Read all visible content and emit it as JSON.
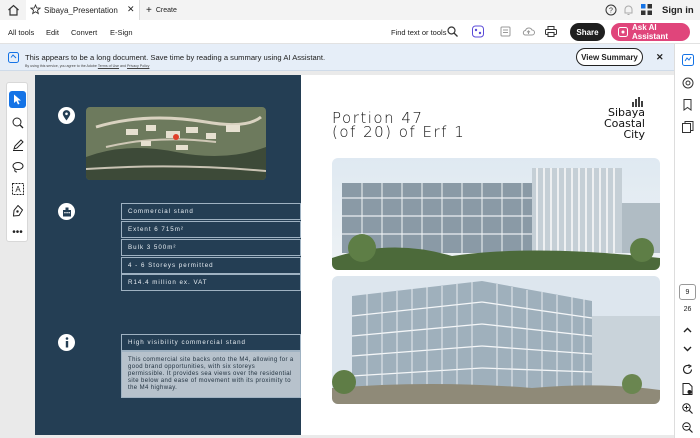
{
  "browser": {
    "tab_title": "Sibaya_Presentation -...",
    "new_tab_label": "Create",
    "sign_in": "Sign in"
  },
  "menu": {
    "items": [
      "All tools",
      "Edit",
      "Convert",
      "E-Sign"
    ],
    "find_label": "Find text or tools",
    "share_label": "Share",
    "ai_label": "Ask AI Assistant"
  },
  "notice": {
    "main_text": "This appears to be a long document. Save time by reading a summary using AI Assistant.",
    "sub_prefix": "By using this service, you agree to the Adobe",
    "terms_link": "Terms of Use",
    "and_text": "and",
    "privacy_link": "Privacy Policy",
    "view_summary": "View Summary"
  },
  "page_nav": {
    "current_page": "9",
    "total_pages": "26"
  },
  "document": {
    "heading_line1": "Portion 47",
    "heading_line2": "(of 20) of Erf 1",
    "logo_line1": "Sibaya",
    "logo_line2": "Coastal",
    "logo_line3": "City",
    "specs": [
      "Commercial stand",
      "Extent 6 715m²",
      "Bulk 3 500m²",
      "4 - 6 Storeys permitted",
      "R14.4 million ex. VAT"
    ],
    "visibility_title": "High visibility commercial stand",
    "visibility_body": "This commercial site backs onto the M4, allowing for a good brand opportunities, with six storeys permissible. It provides sea views over the residential site below and ease of movement with its proximity to the M4 highway."
  },
  "colors": {
    "accent_blue": "#1473e6",
    "page_navy": "#243e54",
    "ai_pink": "#e0457b",
    "share_dark": "#1f1f1f"
  }
}
